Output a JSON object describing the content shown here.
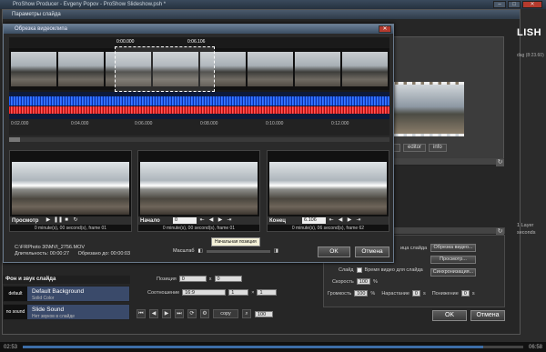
{
  "app": {
    "title": "ProShow Producer - Evgeny Popov - ProShow Slideshow.psh *",
    "brand": "LISH",
    "side_tag": "dag (8:23.60)",
    "layer_info": "1 Layer",
    "layer_sub": "seconds",
    "bottom_time_left": "02:53",
    "bottom_time_right": "06:58"
  },
  "slide_dialog": {
    "title": "Параметры слайда",
    "thumb_buttons": [
      "",
      "editor",
      "info"
    ],
    "ok": "OK",
    "cancel": "Отмена",
    "bg_header": "Фон и звук слайда",
    "background": {
      "tag": "default",
      "title": "Default Background",
      "sub": "Solid Color"
    },
    "sound": {
      "tag": "no sound",
      "title": "Slide Sound",
      "sub": "Нет звуков в слайде"
    },
    "position_label": "Позиция",
    "position_x": "0",
    "position_y": "0",
    "ratio_label": "Соотношение",
    "ratio_value": "16:9",
    "ratio_a": "1",
    "ratio_b": "1",
    "copy_label": "copy",
    "zoom_value": "100",
    "options": {
      "link_label": "ица слайда",
      "slide_label": "Слайд",
      "checkbox_label": "Время видео для слайда",
      "speed_label": "Скорость",
      "speed_value": "100",
      "speed_unit": "%",
      "volume_label": "Громкость",
      "volume_value": "100",
      "volume_unit": "%",
      "fade_in_label": "Нарастание",
      "fade_in_value": "0",
      "fade_in_unit": "s",
      "fade_out_label": "Понижение",
      "fade_out_value": "0",
      "fade_out_unit": "s",
      "btn1": "Обрезка видео...",
      "btn2": "Просмотр...",
      "btn3": "Синхронизация..."
    }
  },
  "trim_dialog": {
    "title": "Обрезка видеоклипа",
    "selection_start": "0:00.000",
    "selection_end": "0:06.106",
    "ruler": [
      "0:02.000",
      "0:04.000",
      "0:06.000",
      "0:08.000",
      "0:10.000",
      "0:12.000"
    ],
    "previews": [
      {
        "label": "Просмотр",
        "value": "",
        "info": "0 minute(s), 00 second(s), frame 01"
      },
      {
        "label": "Начало",
        "value": "0",
        "info": "0 minute(s), 00 second(s), frame 01"
      },
      {
        "label": "Конец",
        "value": "6.106",
        "info": "0 minute(s), 06 second(s), frame 62"
      }
    ],
    "file_path": "C:\\FRPhoto 30\\MVI_2756.MOV",
    "duration_label": "Длительность: 00:00:27",
    "trimmed_label": "Обрезано до: 00:00:03",
    "zoom_label": "Масштаб",
    "tooltip": "Начальная позиция",
    "ok": "OK",
    "cancel": "Отмена"
  }
}
